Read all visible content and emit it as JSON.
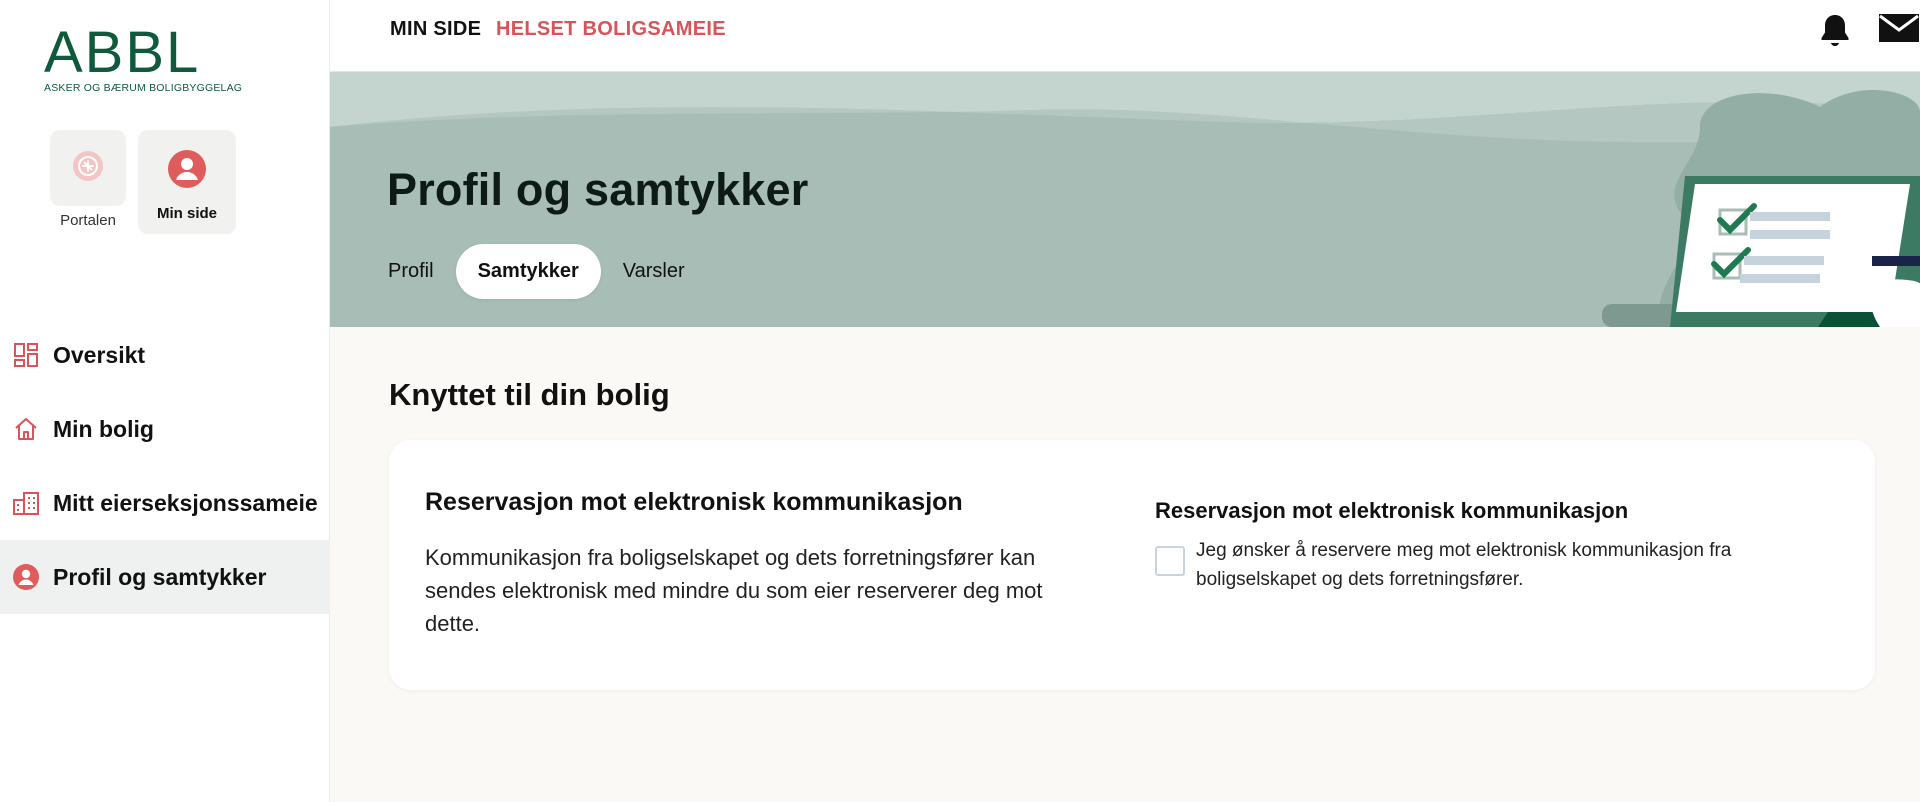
{
  "brand": {
    "logo_text": "ABBL",
    "logo_subtitle": "ASKER OG BÆRUM BOLIGBYGGELAG",
    "color_green": "#0f5a3c",
    "color_accent": "#d9535a"
  },
  "portal_switch": [
    {
      "label": "Portalen",
      "icon": "portal-icon"
    },
    {
      "label": "Min side",
      "icon": "user-avatar-icon",
      "active": true
    }
  ],
  "sidebar": {
    "items": [
      {
        "label": "Oversikt",
        "icon": "dashboard-icon"
      },
      {
        "label": "Min bolig",
        "icon": "home-icon"
      },
      {
        "label": "Mitt eierseksjonssameie",
        "icon": "buildings-icon"
      },
      {
        "label": "Profil og samtykker",
        "icon": "user-circle-icon",
        "active": true
      }
    ]
  },
  "topbar": {
    "min_side": "MIN SIDE",
    "sameie": "HELSET BOLIGSAMEIE",
    "icons": [
      "bell-icon",
      "mail-icon"
    ]
  },
  "hero": {
    "title": "Profil og samtykker",
    "tabs": [
      {
        "label": "Profil"
      },
      {
        "label": "Samtykker",
        "active": true
      },
      {
        "label": "Varsler"
      }
    ]
  },
  "main": {
    "section_title": "Knyttet til din bolig",
    "card": {
      "heading": "Reservasjon mot elektronisk kommunikasjon",
      "body": "Kommunikasjon fra boligselskapet og dets forretningsfører kan sendes elektronisk med mindre du som eier reserverer deg mot dette.",
      "right_heading": "Reservasjon mot elektronisk kommunikasjon",
      "checkbox_label": "Jeg ønsker å reservere meg mot elektronisk kommunikasjon fra boligselskapet og dets forretningsfører.",
      "checkbox_checked": false
    }
  }
}
